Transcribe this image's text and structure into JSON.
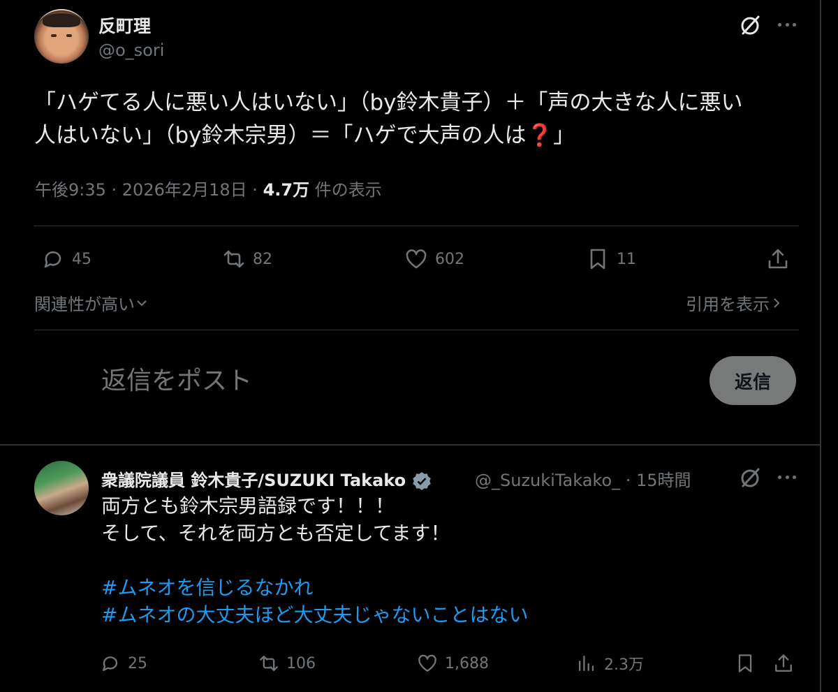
{
  "main_tweet": {
    "author": {
      "name": "反町理",
      "handle": "@o_sori"
    },
    "text_line1": "「ハゲてる人に悪い人はいない」（by鈴木貴子）＋「声の大きな人に悪い",
    "text_line2": "人はいない」（by鈴木宗男）＝「ハゲで大声の人は",
    "text_emoji": "❓",
    "text_end": "」",
    "meta": {
      "time": "午後9:35 · 2026年2月18日 · ",
      "views": "4.7万",
      "views_label": " 件の表示"
    },
    "actions": {
      "replies": "45",
      "reposts": "82",
      "likes": "602",
      "bookmarks": "11"
    },
    "relevance_label": "関連性が高い",
    "quotes_label": "引用を表示",
    "reply_placeholder": "返信をポスト",
    "reply_button": "返信"
  },
  "reply_tweet": {
    "author": {
      "name": "衆議院議員 鈴木貴子/SUZUKI Takako",
      "handle": "@_SuzukiTakako_",
      "time": " · 15時間"
    },
    "line1": "両方とも鈴木宗男語録です！！！",
    "line2": "そして、それを両方とも否定してます！",
    "hashtag1": "#ムネオを信じるなかれ",
    "hashtag2": "#ムネオの大丈夫ほど大丈夫じゃないことはない",
    "actions": {
      "replies": "25",
      "reposts": "106",
      "likes": "1,688",
      "views": "2.3万"
    }
  },
  "colors": {
    "background": "#000000",
    "text": "#e7e9ea",
    "muted": "#71767b",
    "link": "#1d9bf0",
    "verified": "#8a9aa8"
  }
}
